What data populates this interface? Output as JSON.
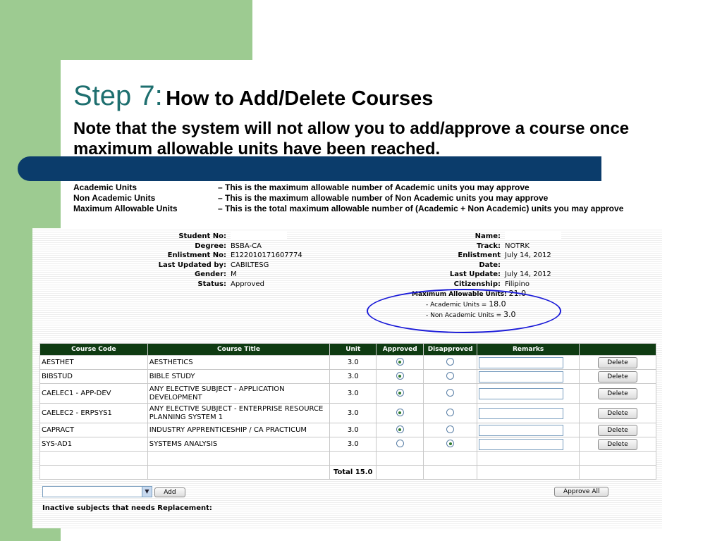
{
  "slide": {
    "step_label": "Step 7:",
    "step_title": "How to Add/Delete Courses",
    "note": "Note that the system will not allow you to add/approve a course once maximum allowable units have been reached.",
    "definitions": [
      {
        "term": "Academic Units",
        "desc": "– This is the maximum allowable number of Academic units you may approve"
      },
      {
        "term": "Non Academic Units",
        "desc": "– This is the maximum allowable number of Non Academic units you may approve"
      },
      {
        "term": "Maximum Allowable Units",
        "desc": "– This is the total maximum allowable number of (Academic + Non Academic) units you may approve"
      }
    ],
    "colors": {
      "accent_green": "#9dcb91",
      "title_teal": "#1e6f6f",
      "bar_blue": "#0b3c6b",
      "header_green": "#0f3b12",
      "ellipse_blue": "#1a1ad8"
    }
  },
  "student": {
    "left": [
      {
        "label": "Student No:",
        "value": ""
      },
      {
        "label": "Degree:",
        "value": "BSBA-CA"
      },
      {
        "label": "Enlistment No:",
        "value": "E122010171607774"
      },
      {
        "label": "Last Updated by:",
        "value": "CABILTESG"
      },
      {
        "label": "Gender:",
        "value": "M"
      },
      {
        "label": "Status:",
        "value": "Approved"
      }
    ],
    "right": [
      {
        "label": "Name:",
        "value": ""
      },
      {
        "label": "Track:",
        "value": "NOTRK"
      },
      {
        "label": "Enlistment Date:",
        "value": "July 14, 2012"
      },
      {
        "label": "Last Update:",
        "value": "July 14, 2012"
      },
      {
        "label": "Citizenship:",
        "value": "Filipino"
      }
    ]
  },
  "units": {
    "max_label": "Maximum Allowable Units:",
    "max_value": "21.0",
    "academic_label": "- Academic Units =",
    "academic_value": "18.0",
    "nonacademic_label": "- Non Academic Units =",
    "nonacademic_value": "3.0"
  },
  "table": {
    "headers": [
      "Course Code",
      "Course Title",
      "Unit",
      "Approved",
      "Disapproved",
      "Remarks",
      ""
    ],
    "rows": [
      {
        "code": "AESTHET",
        "title": "AESTHETICS",
        "unit": "3.0",
        "approved": true,
        "tall": false
      },
      {
        "code": "BIBSTUD",
        "title": "BIBLE STUDY",
        "unit": "3.0",
        "approved": true,
        "tall": false
      },
      {
        "code": "CAELEC1 - APP-DEV",
        "title": "ANY ELECTIVE SUBJECT - APPLICATION DEVELOPMENT",
        "unit": "3.0",
        "approved": true,
        "tall": true
      },
      {
        "code": "CAELEC2 - ERPSYS1",
        "title": "ANY ELECTIVE SUBJECT - ENTERPRISE RESOURCE PLANNING SYSTEM 1",
        "unit": "3.0",
        "approved": true,
        "tall": true
      },
      {
        "code": "CAPRACT",
        "title": "INDUSTRY APPRENTICESHIP / CA PRACTICUM",
        "unit": "3.0",
        "approved": true,
        "tall": false
      },
      {
        "code": "SYS-AD1",
        "title": "SYSTEMS ANALYSIS",
        "unit": "3.0",
        "approved": false,
        "tall": false
      }
    ],
    "delete_label": "Delete",
    "total_label": "Total 15.0"
  },
  "controls": {
    "add_label": "Add",
    "approve_all_label": "Approve All",
    "inactive_label": "Inactive subjects that needs Replacement:"
  }
}
